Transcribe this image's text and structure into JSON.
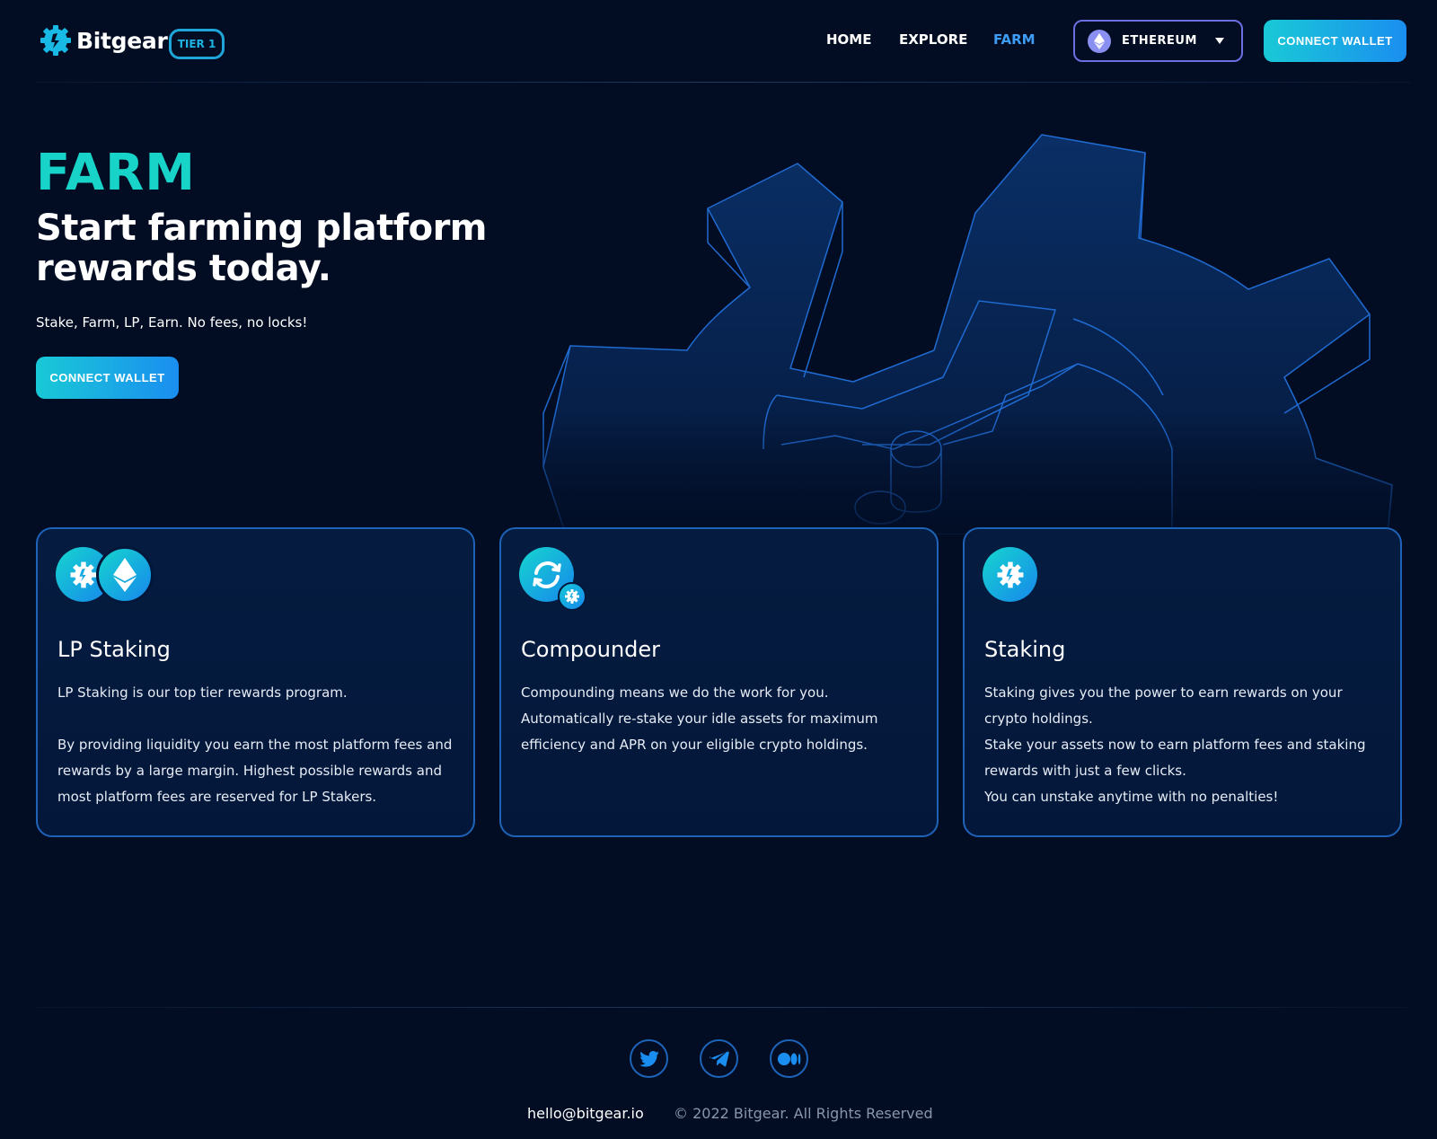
{
  "header": {
    "brand": "Bitgear",
    "tier_badge": "TIER 1",
    "nav": {
      "home": "HOME",
      "explore": "EXPLORE",
      "farm": "FARM"
    },
    "active_nav": "FARM",
    "network": "ETHEREUM",
    "connect_wallet": "CONNECT WALLET"
  },
  "hero": {
    "heading": "FARM",
    "title": "Start farming platform rewards today.",
    "subtitle": "Stake, Farm, LP, Earn. No fees, no locks!",
    "connect_wallet": "CONNECT WALLET"
  },
  "cards": [
    {
      "title": "LP Staking",
      "icons": [
        "bitgear-coin-icon",
        "ethereum-coin-icon"
      ],
      "para1": "LP Staking is our top tier rewards program.",
      "para2": "By providing liquidity you earn the most platform fees and rewards by a large margin. Highest possible rewards and most platform fees are reserved for LP Stakers."
    },
    {
      "title": "Compounder",
      "icons": [
        "refresh-coin-icon",
        "bitgear-badge-icon"
      ],
      "para1": "Compounding means we do the work for you. Automatically re-stake your idle assets for maximum efficiency and APR on your eligible crypto holdings."
    },
    {
      "title": "Staking",
      "icons": [
        "bitgear-coin-icon"
      ],
      "para1": "Staking gives you the power to earn rewards on your crypto holdings.",
      "para2": "Stake your assets now to earn platform fees and staking rewards with just a few clicks.",
      "para3": "You can unstake anytime with no penalties!"
    }
  ],
  "footer": {
    "social": [
      "twitter-icon",
      "telegram-icon",
      "medium-icon"
    ],
    "email": "hello@bitgear.io",
    "copyright": "© 2022 Bitgear. All Rights Reserved"
  },
  "colors": {
    "background": "#020d24",
    "accent_teal": "#18d3c8",
    "accent_blue": "#1a8ef0",
    "active_nav": "#3d9cf5",
    "card_border": "#1d63b8"
  }
}
